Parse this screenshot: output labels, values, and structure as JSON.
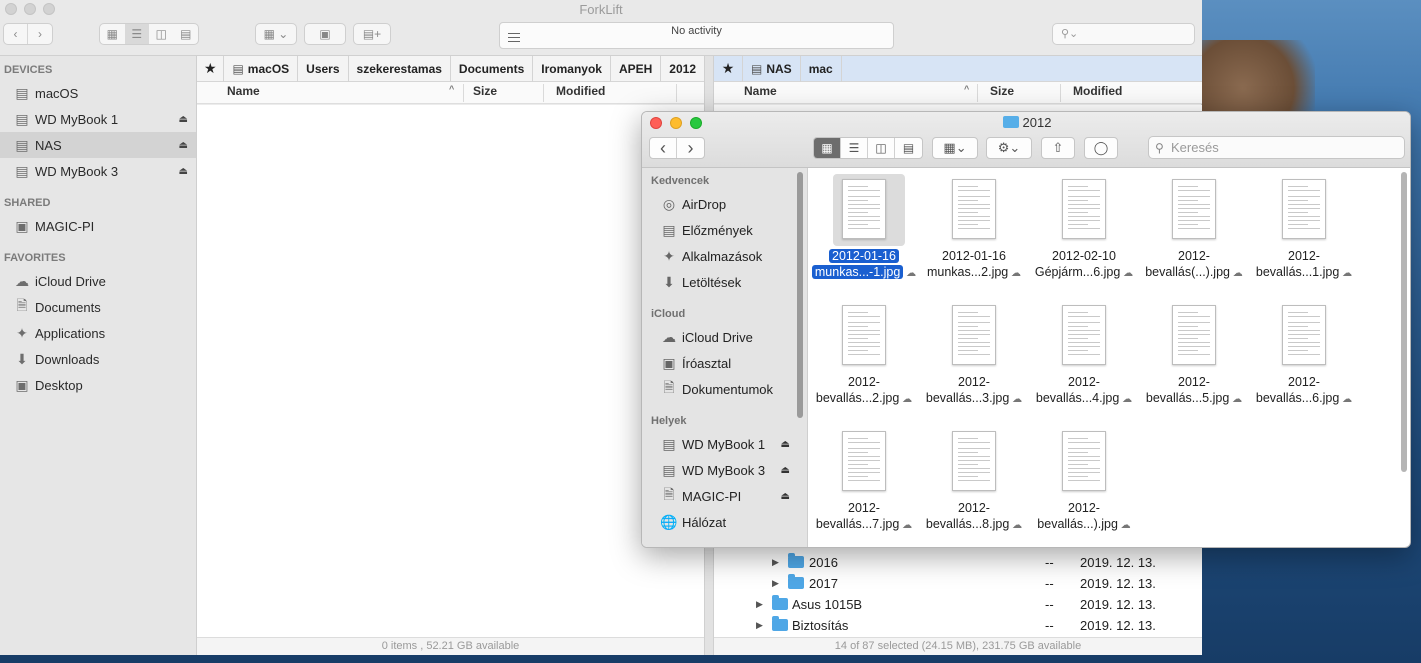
{
  "forklift": {
    "title": "ForkLift",
    "activity": "No activity",
    "search_placeholder": "",
    "sidebar": {
      "devices_label": "DEVICES",
      "devices": [
        {
          "label": "macOS",
          "eject": false
        },
        {
          "label": "WD MyBook 1",
          "eject": true
        },
        {
          "label": "NAS",
          "eject": true,
          "selected": true
        },
        {
          "label": "WD MyBook 3",
          "eject": true
        }
      ],
      "shared_label": "SHARED",
      "shared": [
        {
          "label": "MAGIC-PI"
        }
      ],
      "favorites_label": "FAVORITES",
      "favorites": [
        {
          "label": "iCloud Drive",
          "icon": "cloud-icon"
        },
        {
          "label": "Documents",
          "icon": "document-icon"
        },
        {
          "label": "Applications",
          "icon": "applications-icon"
        },
        {
          "label": "Downloads",
          "icon": "download-icon"
        },
        {
          "label": "Desktop",
          "icon": "desktop-icon"
        }
      ]
    },
    "left_pane": {
      "path": [
        "macOS",
        "Users",
        "szekerestamas",
        "Documents",
        "Iromanyok",
        "APEH",
        "2012"
      ],
      "columns": {
        "name": "Name",
        "size": "Size",
        "modified": "Modified"
      },
      "status": "0 items , 52.21 GB available"
    },
    "right_pane": {
      "path": [
        "NAS",
        "mac"
      ],
      "columns": {
        "name": "Name",
        "size": "Size",
        "modified": "Modified"
      },
      "rows": [
        {
          "name": "2016",
          "size": "--",
          "modified": "2019. 12. 13."
        },
        {
          "name": "2017",
          "size": "--",
          "modified": "2019. 12. 13."
        },
        {
          "name": "Asus 1015B",
          "size": "--",
          "modified": "2019. 12. 13."
        },
        {
          "name": "Biztosítás",
          "size": "--",
          "modified": "2019. 12. 13."
        }
      ],
      "status": "14 of 87 selected  (24.15 MB), 231.75 GB available"
    }
  },
  "finder": {
    "title": "2012",
    "search_placeholder": "Keresés",
    "sidebar": {
      "favorites_label": "Kedvencek",
      "favorites": [
        {
          "label": "AirDrop",
          "icon": "airdrop-icon"
        },
        {
          "label": "Előzmények",
          "icon": "recents-icon"
        },
        {
          "label": "Alkalmazások",
          "icon": "applications-icon"
        },
        {
          "label": "Letöltések",
          "icon": "download-icon"
        }
      ],
      "icloud_label": "iCloud",
      "icloud": [
        {
          "label": "iCloud Drive",
          "icon": "cloud-icon"
        },
        {
          "label": "Íróasztal",
          "icon": "desktop-icon"
        },
        {
          "label": "Dokumentumok",
          "icon": "document-icon"
        }
      ],
      "places_label": "Helyek",
      "places": [
        {
          "label": "WD MyBook 1",
          "icon": "drive-icon",
          "eject": true
        },
        {
          "label": "WD MyBook 3",
          "icon": "drive-icon",
          "eject": true
        },
        {
          "label": "MAGIC-PI",
          "icon": "file-icon",
          "eject": true
        },
        {
          "label": "Hálózat",
          "icon": "network-icon"
        }
      ]
    },
    "files": [
      {
        "line1": "2012-01-16",
        "line2": "munkas...-1.jpg",
        "selected": true
      },
      {
        "line1": "2012-01-16",
        "line2": "munkas...2.jpg"
      },
      {
        "line1": "2012-02-10",
        "line2": "Gépjárm...6.jpg"
      },
      {
        "line1": "2012-",
        "line2": "bevallás(...).jpg"
      },
      {
        "line1": "2012-",
        "line2": "bevallás...1.jpg"
      },
      {
        "line1": "2012-",
        "line2": "bevallás...2.jpg"
      },
      {
        "line1": "2012-",
        "line2": "bevallás...3.jpg"
      },
      {
        "line1": "2012-",
        "line2": "bevallás...4.jpg"
      },
      {
        "line1": "2012-",
        "line2": "bevallás...5.jpg"
      },
      {
        "line1": "2012-",
        "line2": "bevallás...6.jpg"
      },
      {
        "line1": "2012-",
        "line2": "bevallás...7.jpg"
      },
      {
        "line1": "2012-",
        "line2": "bevallás...8.jpg"
      },
      {
        "line1": "2012-",
        "line2": "bevallás...).jpg"
      }
    ]
  }
}
